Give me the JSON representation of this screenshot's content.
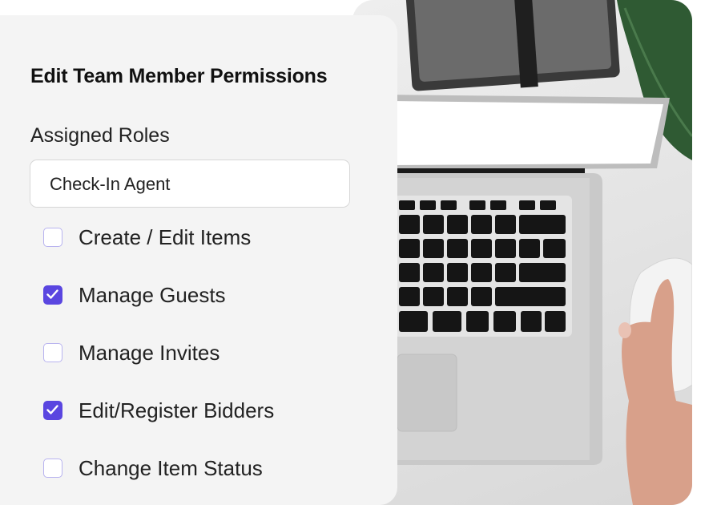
{
  "card": {
    "title": "Edit Team Member Permissions",
    "roles_label": "Assigned Roles",
    "role_value": "Check-In Agent"
  },
  "permissions": [
    {
      "label": "Create / Edit Items",
      "checked": false
    },
    {
      "label": "Manage Guests",
      "checked": true
    },
    {
      "label": "Manage Invites",
      "checked": false
    },
    {
      "label": "Edit/Register Bidders",
      "checked": true
    },
    {
      "label": "Change Item Status",
      "checked": false
    }
  ],
  "colors": {
    "accent": "#5a46e0",
    "checkbox_border": "#b8b3ef",
    "card_bg": "#f4f4f4"
  },
  "photo": {
    "description_icons": [
      "laptop-icon",
      "mouse-icon",
      "notebook-icon",
      "plant-leaf-icon"
    ]
  }
}
